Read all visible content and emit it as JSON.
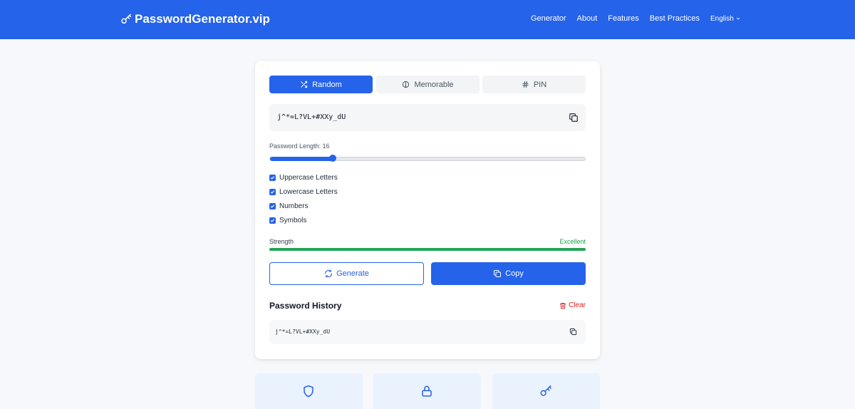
{
  "header": {
    "brand": "PasswordGenerator.vip",
    "brand_icon": "key-icon",
    "nav": [
      "Generator",
      "About",
      "Features",
      "Best Practices"
    ],
    "language": "English"
  },
  "tabs": [
    {
      "label": "Random",
      "icon": "shuffle-icon",
      "active": true
    },
    {
      "label": "Memorable",
      "icon": "brain-icon",
      "active": false
    },
    {
      "label": "PIN",
      "icon": "hash-icon",
      "active": false
    }
  ],
  "password": "j^*=L?VL+#XXy_dU",
  "length_label": "Password Length: 16",
  "length": {
    "value": 16,
    "min": 4,
    "max": 64
  },
  "options": [
    {
      "label": "Uppercase Letters",
      "checked": true
    },
    {
      "label": "Lowercase Letters",
      "checked": true
    },
    {
      "label": "Numbers",
      "checked": true
    },
    {
      "label": "Symbols",
      "checked": true
    }
  ],
  "strength": {
    "label": "Strength",
    "value": "Excellent",
    "level": 1.0,
    "color": "#22a559"
  },
  "buttons": {
    "generate": "Generate",
    "copy": "Copy"
  },
  "history": {
    "title": "Password History",
    "clear_label": "Clear",
    "items": [
      "j^*=L?VL+#XXy_dU"
    ]
  },
  "features": [
    {
      "icon": "shield-icon"
    },
    {
      "icon": "lock-icon"
    },
    {
      "icon": "key-icon"
    }
  ],
  "colors": {
    "primary": "#2563eb",
    "success": "#16a34a",
    "danger": "#dc2626",
    "feature_bg": "#eaf2fe"
  }
}
